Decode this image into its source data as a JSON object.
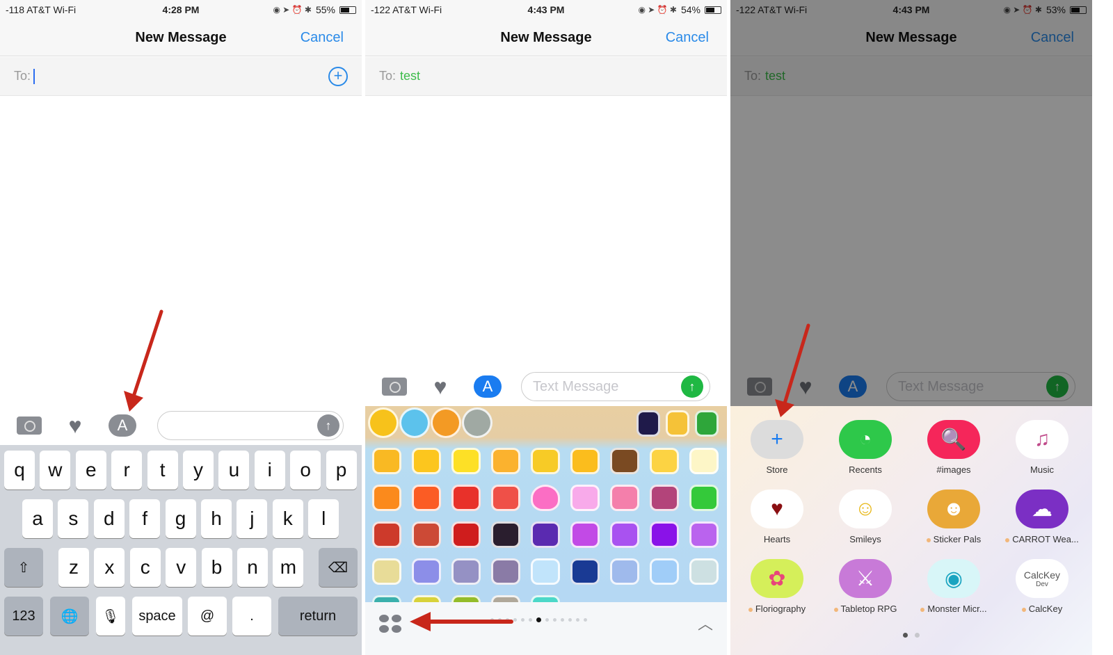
{
  "panels": [
    {
      "status": {
        "carrier": "-118 AT&T Wi-Fi",
        "time": "4:28 PM",
        "battery": "55%",
        "battery_level": 0.55
      },
      "nav": {
        "title": "New Message",
        "cancel": "Cancel"
      },
      "to": {
        "label": "To:",
        "value": ""
      },
      "composer": {
        "placeholder": ""
      },
      "keyboard": {
        "row1": [
          "q",
          "w",
          "e",
          "r",
          "t",
          "y",
          "u",
          "i",
          "o",
          "p"
        ],
        "row2": [
          "a",
          "s",
          "d",
          "f",
          "g",
          "h",
          "j",
          "k",
          "l"
        ],
        "row3": [
          "z",
          "x",
          "c",
          "v",
          "b",
          "n",
          "m"
        ],
        "shift": "⇧",
        "delete": "⌫",
        "num": "123",
        "globe": "🌐",
        "mic": "🎙",
        "space": "space",
        "at": "@",
        "period": ".",
        "return": "return"
      }
    },
    {
      "status": {
        "carrier": "-122 AT&T Wi-Fi",
        "time": "4:43 PM",
        "battery": "54%",
        "battery_level": 0.54
      },
      "nav": {
        "title": "New Message",
        "cancel": "Cancel"
      },
      "to": {
        "label": "To:",
        "value": "test"
      },
      "composer": {
        "placeholder": "Text Message"
      },
      "tray": {
        "page_count": 13,
        "active_page": 6
      }
    },
    {
      "status": {
        "carrier": "-122 AT&T Wi-Fi",
        "time": "4:43 PM",
        "battery": "53%",
        "battery_level": 0.53
      },
      "nav": {
        "title": "New Message",
        "cancel": "Cancel"
      },
      "to": {
        "label": "To:",
        "value": "test"
      },
      "composer": {
        "placeholder": "Text Message"
      },
      "apps": [
        {
          "name": "Store",
          "icon": "plus-icon",
          "color": "#dcdcdc",
          "glyph": "+",
          "new": false
        },
        {
          "name": "Recents",
          "icon": "clock-icon",
          "color": "#2ec84a",
          "glyph": "◔",
          "new": false
        },
        {
          "name": "#images",
          "icon": "globe-search-icon",
          "color": "#f5265a",
          "glyph": "🔍",
          "new": false
        },
        {
          "name": "Music",
          "icon": "music-note-icon",
          "color": "#ffffff",
          "glyph": "♫",
          "new": false
        },
        {
          "name": "Hearts",
          "icon": "heart-icon",
          "color": "#ffffff",
          "glyph": "♥",
          "new": false
        },
        {
          "name": "Smileys",
          "icon": "smiley-icon",
          "color": "#ffffff",
          "glyph": "☺",
          "new": false
        },
        {
          "name": "Sticker Pals",
          "icon": "sticker-pals-icon",
          "color": "#e9a838",
          "glyph": "☻",
          "new": true
        },
        {
          "name": "CARROT Wea...",
          "icon": "cloud-icon",
          "color": "#7b2fc4",
          "glyph": "☁",
          "new": true
        },
        {
          "name": "Floriography",
          "icon": "flower-icon",
          "color": "#d5ef5a",
          "glyph": "✿",
          "new": true
        },
        {
          "name": "Tabletop RPG",
          "icon": "dice-icon",
          "color": "#c87ad8",
          "glyph": "⚔",
          "new": true
        },
        {
          "name": "Monster Micr...",
          "icon": "monster-icon",
          "color": "#d8f6f8",
          "glyph": "◉",
          "new": true
        },
        {
          "name": "CalcKey",
          "icon": "calckey-icon",
          "color": "#ffffff",
          "glyph": "CalcKey",
          "sub": "Dev",
          "new": true
        }
      ],
      "drawer_pages": 2,
      "drawer_active_page": 0
    }
  ],
  "stickers": {
    "top_row": [
      "#f7c21b",
      "#5cc2ec",
      "#f39a24",
      "#a0a9a3"
    ],
    "top_right": [
      "#1f1a4a",
      "#f5c238",
      "#2ea63a"
    ],
    "grid": [
      [
        "#f9b923",
        "#fcc61e",
        "#fde026",
        "#fbb22e",
        "#f7cb26",
        "#fbbd1d",
        "#7a4a22",
        "#fcd343",
        "#fdf6c7"
      ],
      [
        "#fb8a1c",
        "#fb5c24",
        "#e8312a",
        "#ef5048",
        "#fb6ec4",
        "#f8aaea",
        "#f47fab",
        "#b3447a",
        "#34c93a"
      ],
      [
        "#cd3a2b",
        "#cc4a36",
        "#cf1d1d",
        "#2a1e2e",
        "#5a2ab0",
        "#c24ae6",
        "#a952f0",
        "#8a12e8",
        "#ba63ee"
      ],
      [
        "#e8dc98",
        "#8c8ee8",
        "#9591c4",
        "#8a7ba6",
        "#c1e4fb",
        "#1a3a94",
        "#9fbaec",
        "#a0cdf8",
        "#cde0e2"
      ],
      [
        "#3ab0ac",
        "#d8d23a",
        "#94bc2a",
        "#b0a89a",
        "#4cd8c8"
      ]
    ]
  }
}
